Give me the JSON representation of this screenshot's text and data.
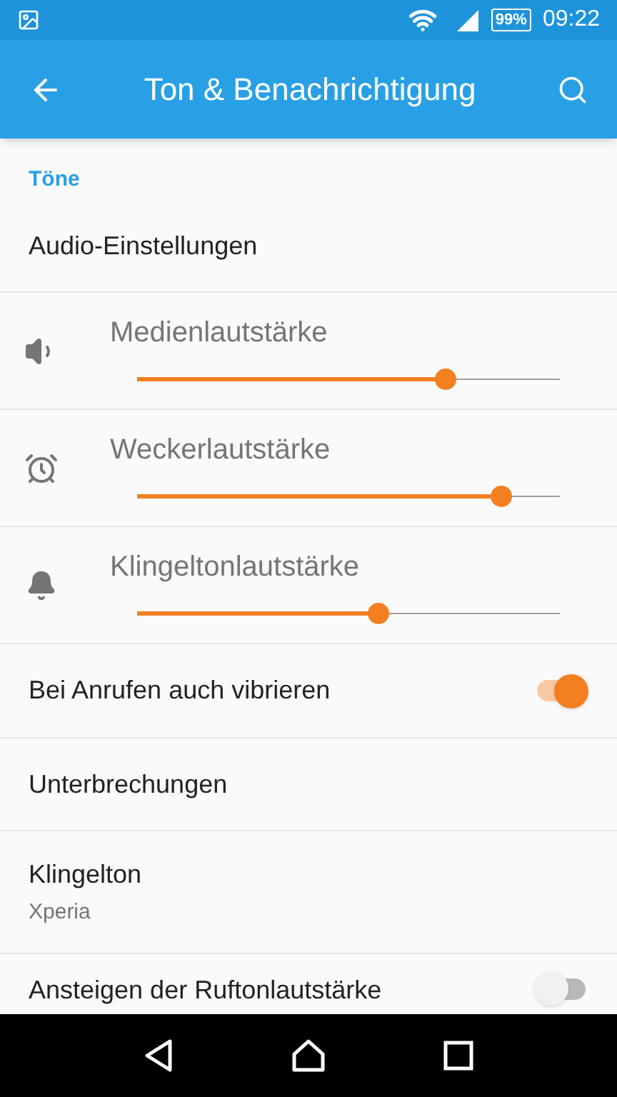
{
  "status_bar": {
    "battery": "99%",
    "time": "09:22"
  },
  "app_bar": {
    "title": "Ton & Benachrichtigung"
  },
  "items": [
    {
      "kind": "header",
      "title": "Töne"
    },
    {
      "kind": "link",
      "title": "Audio-Einstellungen"
    },
    {
      "kind": "slider",
      "title": "Medienlautstärke",
      "level": 0.73
    },
    {
      "kind": "slider",
      "title": "Weckerlautstärke",
      "level": 0.86
    },
    {
      "kind": "slider",
      "title": "Klingeltonlautstärke",
      "level": 0.57
    },
    {
      "kind": "switch",
      "title": "Bei Anrufen auch vibrieren",
      "on": true
    },
    {
      "kind": "link",
      "title": "Unterbrechungen"
    },
    {
      "kind": "link",
      "title": "Klingelton",
      "subtitle": "Xperia"
    },
    {
      "kind": "switch",
      "title": "Ansteigen der Ruftonlautstärke",
      "on": false
    }
  ]
}
